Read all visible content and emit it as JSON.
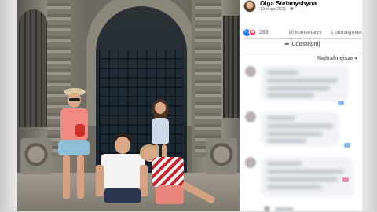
{
  "post": {
    "author": "Olga Stefanyshyna",
    "date": "13 maja 2021",
    "privacy_icon": "globe-icon"
  },
  "stats": {
    "reaction_count": "283",
    "comments": "10 komentarzy",
    "shares": "1 udostępnienie"
  },
  "actions": {
    "share_label": "Udostępnij",
    "share_icon": "share-arrow-icon"
  },
  "comments_sort": {
    "label": "Najtrafniejsze",
    "icon": "caret-down-icon"
  },
  "colors": {
    "like": "#1877f2",
    "love": "#f33e58",
    "panel_bg": "#ffffff",
    "muted_text": "#65676b"
  }
}
